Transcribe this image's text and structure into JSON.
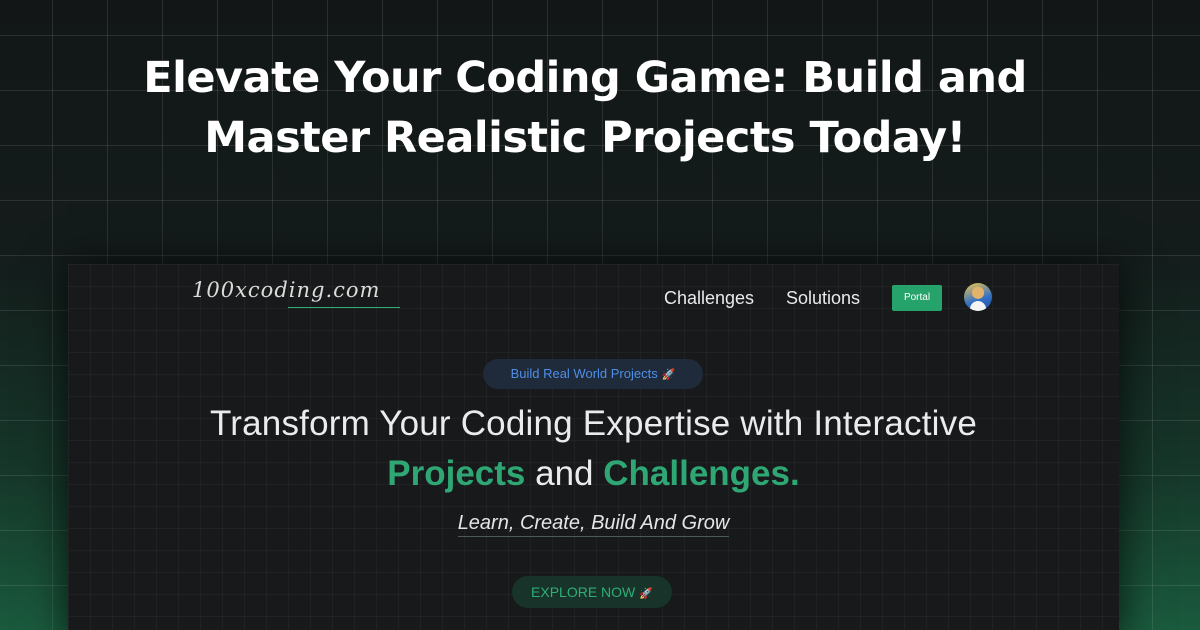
{
  "headline": {
    "line1": "Elevate Your Coding Game: Build and",
    "line2": "Master Realistic Projects Today!"
  },
  "nav": {
    "logo_text": "100xcoding.com",
    "links": [
      "Challenges",
      "Solutions"
    ],
    "portal_label": "Portal",
    "avatar_icon": "user-avatar-icon"
  },
  "hero": {
    "badge_label": "Build Real World Projects",
    "badge_icon": "🚀",
    "line1": "Transform Your Coding Expertise with Interactive",
    "line2_part1": "Projects",
    "line2_and": "and",
    "line2_part2": "Challenges.",
    "tagline": "Learn, Create, Build And Grow",
    "cta_label": "EXPLORE NOW",
    "cta_icon": "🚀"
  },
  "colors": {
    "accent_green": "#2fa774",
    "badge_blue": "#4e8fe6",
    "background_dark": "#18191b"
  }
}
